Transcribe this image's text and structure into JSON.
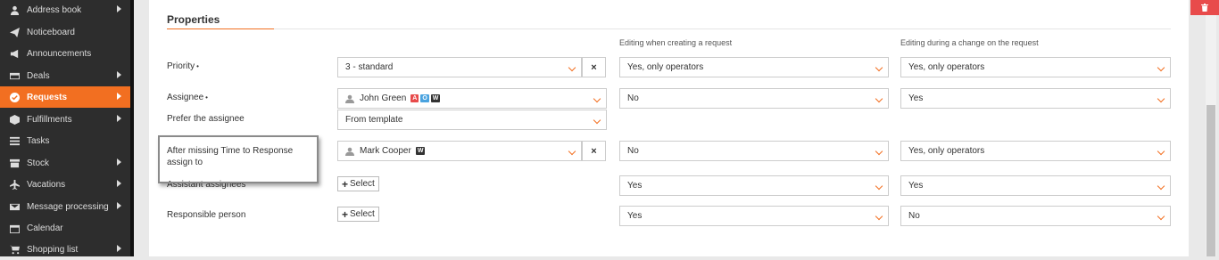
{
  "sidebar": {
    "items": [
      {
        "label": "Address book",
        "icon": "user-icon",
        "arrow": true,
        "active": false
      },
      {
        "label": "Noticeboard",
        "icon": "paper-plane-icon",
        "arrow": false,
        "active": false
      },
      {
        "label": "Announcements",
        "icon": "megaphone-icon",
        "arrow": false,
        "active": false
      },
      {
        "label": "Deals",
        "icon": "credit-card-icon",
        "arrow": true,
        "active": false
      },
      {
        "label": "Requests",
        "icon": "check-circle-icon",
        "arrow": true,
        "active": true
      },
      {
        "label": "Fulfillments",
        "icon": "cube-icon",
        "arrow": true,
        "active": false
      },
      {
        "label": "Tasks",
        "icon": "list-icon",
        "arrow": false,
        "active": false
      },
      {
        "label": "Stock",
        "icon": "box-icon",
        "arrow": true,
        "active": false
      },
      {
        "label": "Vacations",
        "icon": "plane-icon",
        "arrow": true,
        "active": false
      },
      {
        "label": "Message processing",
        "icon": "envelope-icon",
        "arrow": true,
        "active": false
      },
      {
        "label": "Calendar",
        "icon": "calendar-icon",
        "arrow": false,
        "active": false
      },
      {
        "label": "Shopping list",
        "icon": "cart-icon",
        "arrow": true,
        "active": false
      }
    ],
    "accent": "#f26f21"
  },
  "section": {
    "title": "Properties"
  },
  "columns": {
    "create": "Editing when creating a request",
    "change": "Editing during a change on the request"
  },
  "rows": {
    "priority": {
      "label": "Priority",
      "required": "•",
      "value": "3 - standard",
      "clear": "×",
      "create": "Yes, only operators",
      "change": "Yes, only operators"
    },
    "assignee": {
      "label": "Assignee",
      "required": "•",
      "value": "John Green",
      "badges": [
        {
          "text": "A",
          "color": "#e84b4b"
        },
        {
          "text": "O",
          "color": "#4aa3df"
        },
        {
          "text": "W",
          "color": "#333333"
        }
      ],
      "create": "No",
      "change": "Yes"
    },
    "prefer": {
      "label": "Prefer the assignee",
      "value": "From template"
    },
    "after_missing": {
      "label": "After missing Time to Response assign to",
      "value": "Mark Cooper",
      "badge": {
        "text": "W",
        "color": "#333333"
      },
      "clear": "×",
      "create": "No",
      "change": "Yes, only operators"
    },
    "assistant": {
      "label": "Assistant assignees",
      "button": "Select",
      "plus": "+",
      "create": "Yes",
      "change": "Yes"
    },
    "responsible": {
      "label": "Responsible person",
      "button": "Select",
      "plus": "+",
      "create": "Yes",
      "change": "No"
    }
  },
  "delete_button": {
    "icon": "trash-icon",
    "color": "#e84b4b"
  }
}
